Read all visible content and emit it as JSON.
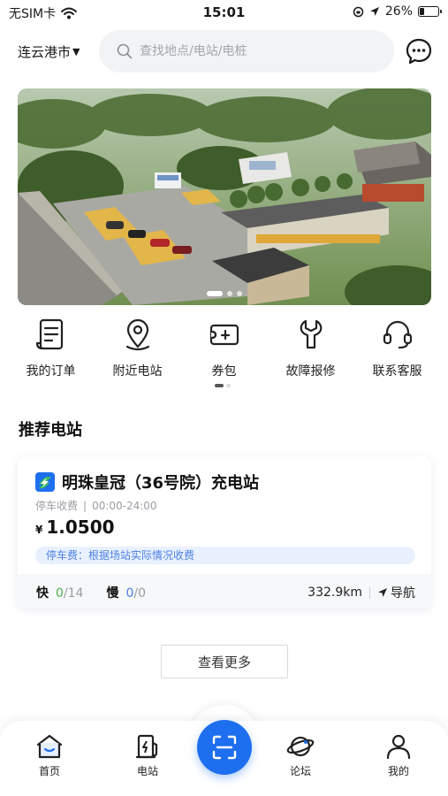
{
  "status_bar": {
    "carrier": "无SIM卡",
    "time": "15:01",
    "battery_percent": "26%",
    "battery_level": 0.26,
    "icons": [
      "wifi-icon",
      "lock-rotation-icon",
      "location-arrow-icon",
      "battery-icon"
    ]
  },
  "header": {
    "city": "连云港市",
    "search_placeholder": "查找地点/电站/电桩",
    "message_icon": "chat-bubble-icon"
  },
  "banner": {
    "slide_count": 3,
    "active_slide": 1
  },
  "quick_menu": {
    "items": [
      {
        "label": "我的订单",
        "icon": "order-list-icon"
      },
      {
        "label": "附近电站",
        "icon": "map-pin-icon"
      },
      {
        "label": "券包",
        "icon": "coupon-wallet-icon"
      },
      {
        "label": "故障报修",
        "icon": "wrench-icon"
      },
      {
        "label": "联系客服",
        "icon": "headset-icon"
      }
    ],
    "page_count": 2,
    "active_page": 1
  },
  "recommend": {
    "title": "推荐电站",
    "station": {
      "name": "明珠皇冠（36号院）充电站",
      "parking": "停车收费",
      "hours": "00:00-24:00",
      "currency": "¥",
      "price": "1.0500",
      "fee_note": "停车费：根据场站实际情况收费",
      "fast_label": "快",
      "fast_free": "0",
      "fast_total": "/14",
      "slow_label": "慢",
      "slow_free": "0",
      "slow_total": "/0",
      "distance": "332.9km",
      "nav_label": "导航"
    },
    "more_label": "查看更多"
  },
  "tabbar": {
    "items": [
      {
        "label": "首页",
        "icon": "home-icon"
      },
      {
        "label": "电站",
        "icon": "charging-station-icon"
      },
      {
        "label": "论坛",
        "icon": "planet-icon"
      },
      {
        "label": "我的",
        "icon": "user-icon"
      }
    ],
    "scan_icon": "scan-icon"
  },
  "colors": {
    "accent": "#1e6ff0",
    "fast_green": "#4caf50",
    "slow_blue": "#4a7fe3",
    "fee_bg": "#e9f1ff"
  }
}
